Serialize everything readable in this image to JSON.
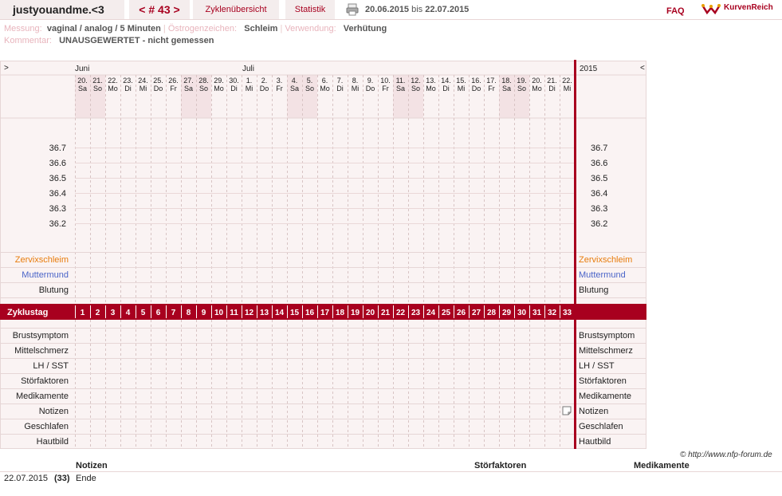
{
  "header": {
    "username": "justyouandme.<3",
    "cycle_nav": "< # 43 >",
    "tab_overview": "Zyklenübersicht",
    "tab_stats": "Statistik",
    "date_from": "20.06.2015",
    "date_sep": "bis",
    "date_to": "22.07.2015",
    "faq": "FAQ",
    "logo": "KurvenReich"
  },
  "meta": {
    "measurement_label": "Messung:",
    "measurement": "vaginal / analog / 5 Minuten",
    "estrogen_label": "Östrogenzeichen:",
    "estrogen": "Schleim",
    "usage_label": "Verwendung:",
    "usage": "Verhütung",
    "comment_label": "Kommentar:",
    "comment": "UNAUSGEWERTET - nicht gemessen"
  },
  "chart": {
    "nav_prev": ">",
    "nav_next": "<",
    "month_1": "Juni",
    "month_2": "Juli",
    "year": "2015",
    "days": [
      {
        "d": "20.",
        "w": "Sa",
        "we": true
      },
      {
        "d": "21.",
        "w": "So",
        "we": true
      },
      {
        "d": "22.",
        "w": "Mo",
        "we": false
      },
      {
        "d": "23.",
        "w": "Di",
        "we": false
      },
      {
        "d": "24.",
        "w": "Mi",
        "we": false
      },
      {
        "d": "25.",
        "w": "Do",
        "we": false
      },
      {
        "d": "26.",
        "w": "Fr",
        "we": false
      },
      {
        "d": "27.",
        "w": "Sa",
        "we": true
      },
      {
        "d": "28.",
        "w": "So",
        "we": true
      },
      {
        "d": "29.",
        "w": "Mo",
        "we": false
      },
      {
        "d": "30.",
        "w": "Di",
        "we": false
      },
      {
        "d": "1.",
        "w": "Mi",
        "we": false
      },
      {
        "d": "2.",
        "w": "Do",
        "we": false
      },
      {
        "d": "3.",
        "w": "Fr",
        "we": false
      },
      {
        "d": "4.",
        "w": "Sa",
        "we": true
      },
      {
        "d": "5.",
        "w": "So",
        "we": true
      },
      {
        "d": "6.",
        "w": "Mo",
        "we": false
      },
      {
        "d": "7.",
        "w": "Di",
        "we": false
      },
      {
        "d": "8.",
        "w": "Mi",
        "we": false
      },
      {
        "d": "9.",
        "w": "Do",
        "we": false
      },
      {
        "d": "10.",
        "w": "Fr",
        "we": false
      },
      {
        "d": "11.",
        "w": "Sa",
        "we": true
      },
      {
        "d": "12.",
        "w": "So",
        "we": true
      },
      {
        "d": "13.",
        "w": "Mo",
        "we": false
      },
      {
        "d": "14.",
        "w": "Di",
        "we": false
      },
      {
        "d": "15.",
        "w": "Mi",
        "we": false
      },
      {
        "d": "16.",
        "w": "Do",
        "we": false
      },
      {
        "d": "17.",
        "w": "Fr",
        "we": false
      },
      {
        "d": "18.",
        "w": "Sa",
        "we": true
      },
      {
        "d": "19.",
        "w": "So",
        "we": true
      },
      {
        "d": "20.",
        "w": "Mo",
        "we": false
      },
      {
        "d": "21.",
        "w": "Di",
        "we": false
      },
      {
        "d": "22.",
        "w": "Mi",
        "we": false
      }
    ],
    "temps": [
      "36.7",
      "36.6",
      "36.5",
      "36.4",
      "36.3",
      "36.2"
    ],
    "rows_top": [
      {
        "label": "Zervixschleim",
        "color": "#e87c0c"
      },
      {
        "label": "Muttermund",
        "color": "#4a64c8"
      },
      {
        "label": "Blutung",
        "color": "#222222"
      }
    ],
    "cycle_day_label": "Zyklustag",
    "cycle_days": [
      "1",
      "2",
      "3",
      "4",
      "5",
      "6",
      "7",
      "8",
      "9",
      "10",
      "11",
      "12",
      "13",
      "14",
      "15",
      "16",
      "17",
      "18",
      "19",
      "20",
      "21",
      "22",
      "23",
      "24",
      "25",
      "26",
      "27",
      "28",
      "29",
      "30",
      "31",
      "32",
      "33"
    ],
    "rows_bottom": [
      "Brustsymptom",
      "Mittelschmerz",
      "LH / SST",
      "Störfaktoren",
      "Medikamente",
      "Notizen",
      "Geschlafen",
      "Hautbild"
    ],
    "note_icon": "note-icon",
    "accent": "#a8001f"
  },
  "footer": {
    "copyright": "© http://www.nfp-forum.de",
    "col_notes": "Notizen",
    "col_disturb": "Störfaktoren",
    "col_meds": "Medikamente",
    "entry_date": "22.07.2015",
    "entry_day": "(33)",
    "entry_note": "Ende"
  }
}
